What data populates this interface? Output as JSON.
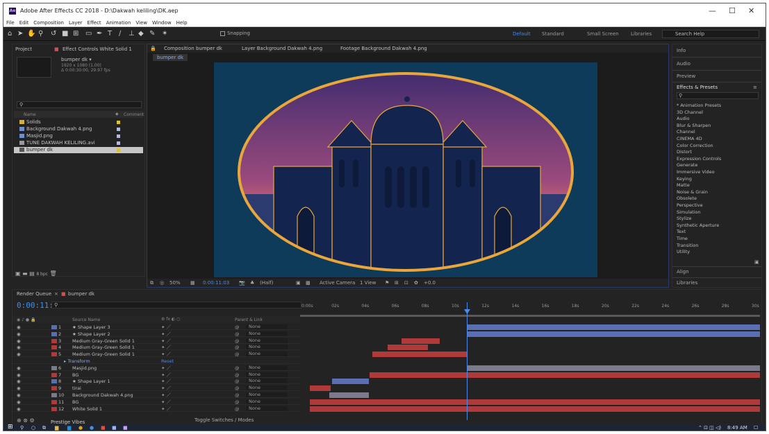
{
  "window": {
    "title": "Adobe After Effects CC 2018 - D:\\Dakwah keliling\\DK.aep",
    "min": "—",
    "max": "☐",
    "close": "✕"
  },
  "menu": [
    "File",
    "Edit",
    "Composition",
    "Layer",
    "Effect",
    "Animation",
    "View",
    "Window",
    "Help"
  ],
  "toolbar": {
    "snapping": "Snapping",
    "workspaces": [
      "Default",
      "Standard",
      "Small Screen",
      "Libraries"
    ],
    "search_help": "Search Help"
  },
  "project": {
    "tab_project": "Project",
    "tab_effects": "Effect Controls White Solid 1",
    "comp_name": "bumper dk ▾",
    "comp_size": "1920 x 1080 (1.00)",
    "comp_dur": "Δ 0:00:30:00, 29.97 fps",
    "col_name": "Name",
    "col_comment": "Comment",
    "items": [
      {
        "name": "Solids",
        "type": "folder",
        "swatch": "#d9c13a"
      },
      {
        "name": "Background Dakwah 4.png",
        "type": "image",
        "swatch": "#b8b8d8"
      },
      {
        "name": "Masjid.png",
        "type": "image",
        "swatch": "#b8b8d8"
      },
      {
        "name": "TUNE DAKWAH KELILING.avi",
        "type": "video",
        "swatch": "#b8b8d8"
      },
      {
        "name": "bumper dk",
        "type": "comp",
        "swatch": "#d9c13a"
      }
    ],
    "bpc": "8 bpc"
  },
  "composition": {
    "tab_comp": "Composition bumper dk",
    "tab_layer": "Layer Background Dakwah 4.png",
    "tab_footage": "Footage Background Dakwah 4.png",
    "sub_tab": "bumper dk",
    "zoom": "50%",
    "time": "0:00:11:03",
    "resolution": "(Half)",
    "camera": "Active Camera",
    "view": "1 View",
    "exposure": "+0.0"
  },
  "right_panel": {
    "info": "Info",
    "audio": "Audio",
    "preview": "Preview",
    "effects_presets": "Effects & Presets",
    "effects": [
      "* Animation Presets",
      "3D Channel",
      "Audio",
      "Blur & Sharpen",
      "Channel",
      "CINEMA 4D",
      "Color Correction",
      "Distort",
      "Expression Controls",
      "Generate",
      "Immersive Video",
      "Keying",
      "Matte",
      "Noise & Grain",
      "Obsolete",
      "Perspective",
      "Simulation",
      "Stylize",
      "Synthetic Aperture",
      "Text",
      "Time",
      "Transition",
      "Utility"
    ],
    "align": "Align",
    "libraries": "Libraries"
  },
  "timeline": {
    "tab_render": "Render Queue",
    "tab_comp": "bumper dk",
    "timecode": "0:00:11:03",
    "col_source": "Source Name",
    "col_parent": "Parent & Link",
    "ruler": [
      "0:00s",
      "02s",
      "04s",
      "06s",
      "08s",
      "10s",
      "12s",
      "14s",
      "16s",
      "18s",
      "20s",
      "22s",
      "24s",
      "26s",
      "28s",
      "30s"
    ],
    "layers": [
      {
        "num": "1",
        "name": "★ Shape Layer 3",
        "parent": "None",
        "color": "#5a6fb3"
      },
      {
        "num": "2",
        "name": "★ Shape Layer 2",
        "parent": "None",
        "color": "#5a6fb3"
      },
      {
        "num": "3",
        "name": "Medium Gray-Green Solid 1",
        "parent": "None",
        "color": "#b03a3a"
      },
      {
        "num": "4",
        "name": "Medium Gray-Green Solid 1",
        "parent": "None",
        "color": "#b03a3a"
      },
      {
        "num": "5",
        "name": "Medium Gray-Green Solid 1",
        "parent": "None",
        "color": "#b03a3a"
      },
      {
        "num": "",
        "name": "▸ Transform",
        "parent": "Reset",
        "color": ""
      },
      {
        "num": "6",
        "name": "Masjid.png",
        "parent": "None",
        "color": "#7a7a8a"
      },
      {
        "num": "7",
        "name": "BG",
        "parent": "None",
        "color": "#b03a3a"
      },
      {
        "num": "8",
        "name": "★ Shape Layer 1",
        "parent": "None",
        "color": "#5a6fb3"
      },
      {
        "num": "9",
        "name": "tirai",
        "parent": "None",
        "color": "#b03a3a"
      },
      {
        "num": "10",
        "name": "Background Dakwah 4.png",
        "parent": "None",
        "color": "#7a7a8a"
      },
      {
        "num": "11",
        "name": "BG",
        "parent": "None",
        "color": "#b03a3a"
      },
      {
        "num": "12",
        "name": "White Solid 1",
        "parent": "None",
        "color": "#b03a3a"
      }
    ],
    "toggle": "Toggle Switches / Modes"
  },
  "taskbar": {
    "time": "8:49 AM",
    "music": "Prestige Vibes"
  }
}
